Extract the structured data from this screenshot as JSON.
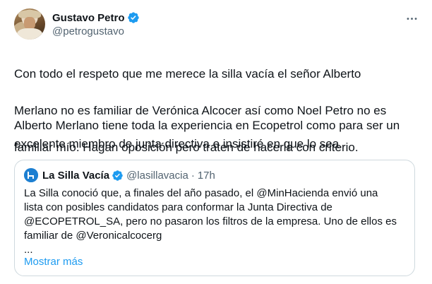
{
  "tweet": {
    "author": {
      "name": "Gustavo Petro",
      "handle": "@petrogustavo"
    },
    "text_lines": [
      "Con todo el respeto que me merece la silla vacía el señor Alberto",
      "Merlano no es familiar de Verónica Alcocer así como Noel Petro no es",
      "familiar mío. Hagan oposición pero traten de hacerla con criterio."
    ],
    "text_lines_2": [
      "Alberto Merlano tiene toda la experiencia en Ecopetrol como para ser un",
      "excelente miembro de junta directiva e insistiré en que lo sea."
    ]
  },
  "quote": {
    "name": "La Silla Vacía",
    "handle": "@lasillavacia",
    "separator": "·",
    "time": "17h",
    "body_lines": [
      "La Silla conoció que, a finales del año pasado, el @MinHacienda envió una",
      "lista con posibles candidatos para conformar la Junta Directiva de",
      "@ECOPETROL_SA, pero no pasaron los filtros de la empresa. Uno de ellos es",
      "familiar de @Veronicalcocerg",
      "..."
    ],
    "show_more": "Mostrar más"
  },
  "colors": {
    "verified": "#1d9bf0",
    "link": "#1d9bf0",
    "secondary_text": "#536471",
    "border": "#cfd9de"
  },
  "icons": {
    "verified": "verified-badge-icon",
    "more": "more-horizontal-icon"
  }
}
